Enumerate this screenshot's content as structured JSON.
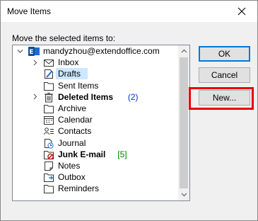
{
  "window": {
    "title": "Move Items",
    "close_glyph": "✕"
  },
  "prompt": "Move the selected items to:",
  "tree": {
    "account": "mandyzhou@extendoffice.com",
    "folders": [
      {
        "label": "Inbox",
        "icon": "inbox-icon",
        "expandable": true
      },
      {
        "label": "Drafts",
        "icon": "drafts-icon",
        "selected": true
      },
      {
        "label": "Sent Items",
        "icon": "folder-icon"
      },
      {
        "label": "Deleted Items",
        "icon": "trash-icon",
        "bold": true,
        "count": "(2)",
        "count_color": "#0033cc",
        "expandable": true
      },
      {
        "label": "Archive",
        "icon": "folder-icon"
      },
      {
        "label": "Calendar",
        "icon": "calendar-icon"
      },
      {
        "label": "Contacts",
        "icon": "contacts-icon"
      },
      {
        "label": "Journal",
        "icon": "journal-icon"
      },
      {
        "label": "Junk E-mail",
        "icon": "junk-icon",
        "bold": true,
        "count": "[5]",
        "count_color": "#008000"
      },
      {
        "label": "Notes",
        "icon": "notes-icon"
      },
      {
        "label": "Outbox",
        "icon": "outbox-icon"
      },
      {
        "label": "Reminders",
        "icon": "folder-icon"
      }
    ]
  },
  "buttons": {
    "ok": "OK",
    "cancel": "Cancel",
    "new": "New..."
  },
  "colors": {
    "highlight": "#e8000b",
    "selection": "#cce8ff",
    "accent": "#0078d7"
  }
}
